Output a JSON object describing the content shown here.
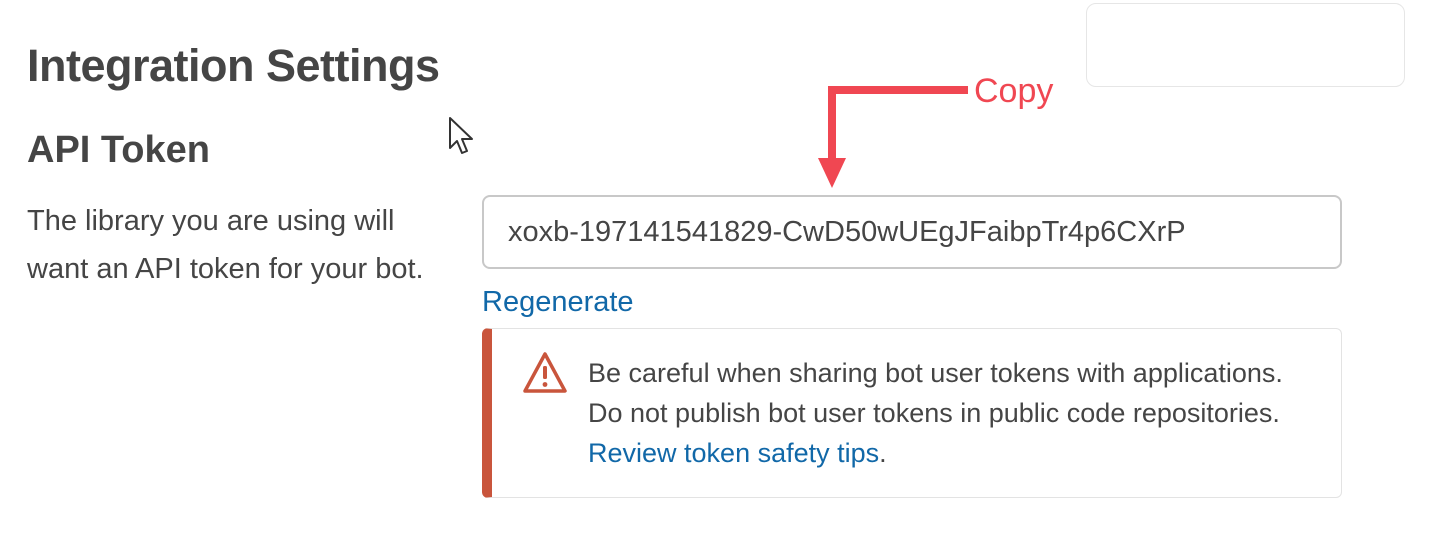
{
  "page": {
    "title": "Integration Settings"
  },
  "api_token": {
    "heading": "API Token",
    "description": "The library you are using will want an API token for your bot.",
    "token_value": "xoxb-197141541829-CwD50wUEgJFaibpTr4p6CXrP",
    "regenerate_label": "Regenerate"
  },
  "warning": {
    "text": "Be careful when sharing bot user tokens with applications. Do not publish bot user tokens in public code repositories.",
    "link_label": "Review token safety tips",
    "suffix": ".",
    "icon": "warning-triangle-icon",
    "accent_color": "#c9553c"
  },
  "annotation": {
    "label": "Copy",
    "color": "#f04752"
  },
  "colors": {
    "text": "#454545",
    "link": "#1168a8",
    "input_border": "#c8c8c8"
  }
}
